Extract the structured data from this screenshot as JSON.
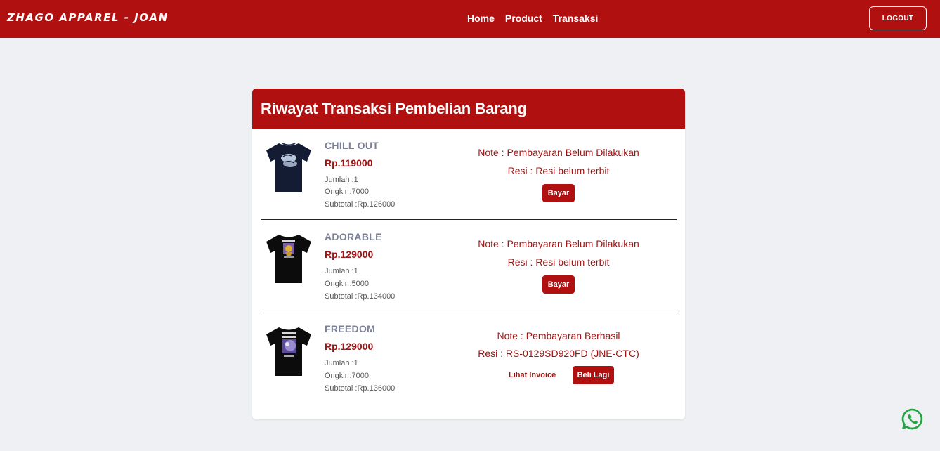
{
  "navbar": {
    "brand": "ZHAGO APPAREL - JOAN",
    "links": [
      "Home",
      "Product",
      "Transaksi"
    ],
    "logout": "LOGOUT"
  },
  "card": {
    "title": "Riwayat Transaksi Pembelian Barang"
  },
  "items": [
    {
      "name": "CHILL OUT",
      "price": "Rp.119000",
      "jumlah": "Jumlah :1",
      "ongkir": "Ongkir :7000",
      "subtotal": "Subtotal :Rp.126000",
      "note": "Note : Pembayaran Belum Dilakukan",
      "resi": "Resi : Resi belum terbit",
      "button": "Bayar"
    },
    {
      "name": "ADORABLE",
      "price": "Rp.129000",
      "jumlah": "Jumlah :1",
      "ongkir": "Ongkir :5000",
      "subtotal": "Subtotal :Rp.134000",
      "note": "Note : Pembayaran Belum Dilakukan",
      "resi": "Resi : Resi belum terbit",
      "button": "Bayar"
    },
    {
      "name": "FREEDOM",
      "price": "Rp.129000",
      "jumlah": "Jumlah :1",
      "ongkir": "Ongkir :7000",
      "subtotal": "Subtotal :Rp.136000",
      "note": "Note : Pembayaran Berhasil",
      "resi": "Resi : RS-0129SD920FD (JNE-CTC)",
      "invoice_link": "Lihat Invoice",
      "button": "Beli Lagi"
    }
  ],
  "colors": {
    "primary": "#b01010",
    "background": "#eef0f3",
    "accent_text": "#a01414",
    "whatsapp": "#25a244"
  },
  "icons": {
    "whatsapp": "whatsapp-icon"
  }
}
